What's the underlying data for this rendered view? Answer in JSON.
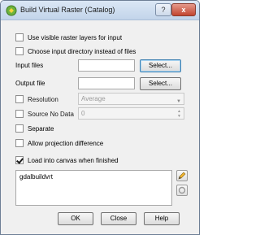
{
  "window": {
    "title": "Build Virtual Raster (Catalog)",
    "help_label": "?",
    "close_label": "x"
  },
  "options": {
    "use_visible_layers": "Use visible raster layers for input",
    "choose_directory": "Choose input directory instead of files"
  },
  "input_files": {
    "label": "Input files",
    "value": "",
    "button": "Select..."
  },
  "output_file": {
    "label": "Output file",
    "value": "",
    "button": "Select..."
  },
  "resolution": {
    "label": "Resolution",
    "value": "Average",
    "checked": false
  },
  "source_nodata": {
    "label": "Source No Data",
    "value": "0",
    "checked": false
  },
  "separate": {
    "label": "Separate",
    "checked": false
  },
  "allow_projection": {
    "label": "Allow projection difference",
    "checked": false
  },
  "load_canvas": {
    "label": "Load into canvas when finished",
    "checked": true
  },
  "command": {
    "text": "gdalbuildvrt"
  },
  "buttons": {
    "ok": "OK",
    "close": "Close",
    "help": "Help"
  },
  "colors": {
    "title_bar": "#c9d9ee",
    "close_button": "#c2452f",
    "dialog_bg": "#f0f0f0"
  }
}
